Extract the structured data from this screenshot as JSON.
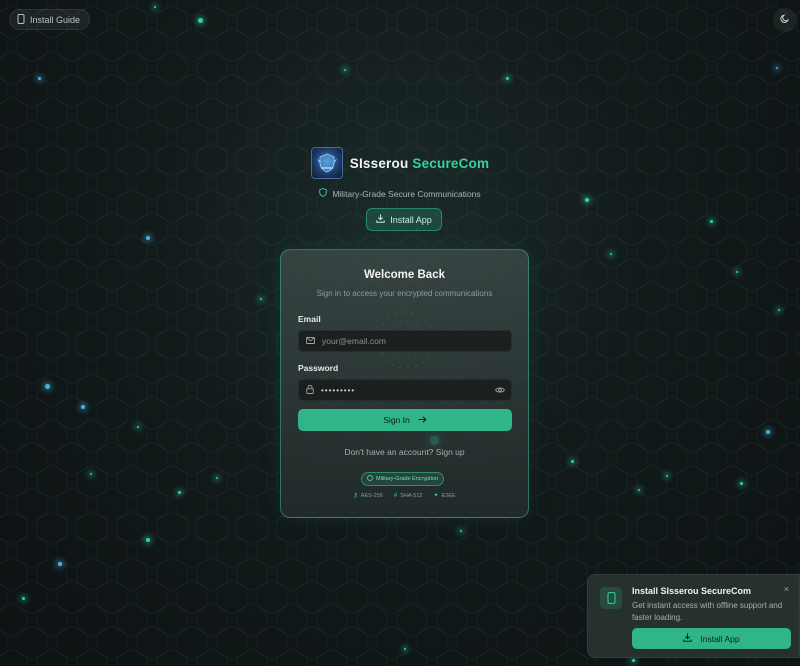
{
  "header": {
    "install_guide_label": "Install Guide",
    "install_guide_icon": "phone-icon",
    "theme_toggle_icon": "moon-icon"
  },
  "brand": {
    "name_part1": "SIsserou",
    "name_part2": "SecureCom",
    "accent_color": "#35d39d",
    "tagline": "Military-Grade Secure Communications",
    "tagline_icon": "shield-icon",
    "install_app_label": "Install App"
  },
  "login": {
    "title": "Welcome Back",
    "subtitle": "Sign in to access your encrypted communications",
    "email_label": "Email",
    "email_placeholder": "your@email.com",
    "password_label": "Password",
    "password_value": "•••••••••",
    "signin_label": "Sign In",
    "signup_prompt": "Don't have an account?",
    "signup_link": "Sign up",
    "badge_label": "Military-Grade Encryption",
    "features": [
      "AES-256",
      "SHA-512",
      "E2EE"
    ]
  },
  "toast": {
    "title": "Install SIsserou SecureCom",
    "description": "Get instant access with offline support and faster loading.",
    "button_label": "Install App",
    "close_label": "×"
  }
}
